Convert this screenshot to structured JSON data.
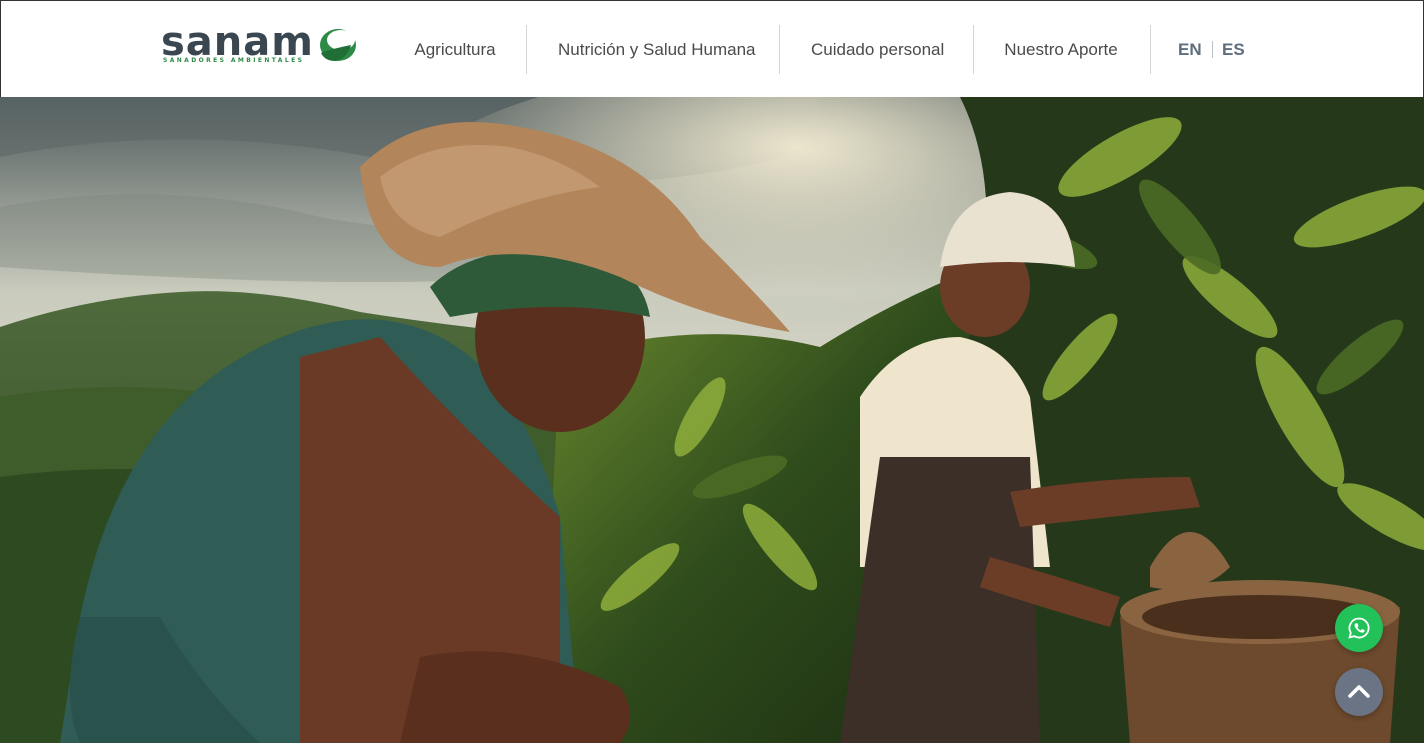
{
  "brand": {
    "name": "sanam",
    "tagline": "SANADORES AMBIENTALES",
    "colors": {
      "text": "#3a4750",
      "green": "#2d8b47"
    }
  },
  "nav": {
    "items": [
      {
        "label": "Agricultura"
      },
      {
        "label": "Nutrición y Salud Humana"
      },
      {
        "label": "Cuidado personal"
      },
      {
        "label": "Nuestro Aporte"
      }
    ],
    "languages": [
      {
        "label": "EN"
      },
      {
        "label": "ES"
      }
    ]
  },
  "hero": {
    "image": "coffee-farm-workers-photo"
  },
  "floating": {
    "whatsapp_icon": "whatsapp-icon",
    "scroll_top_icon": "chevron-up-icon",
    "colors": {
      "whatsapp": "#22c15a",
      "scroll_top": "#6b7485"
    }
  }
}
